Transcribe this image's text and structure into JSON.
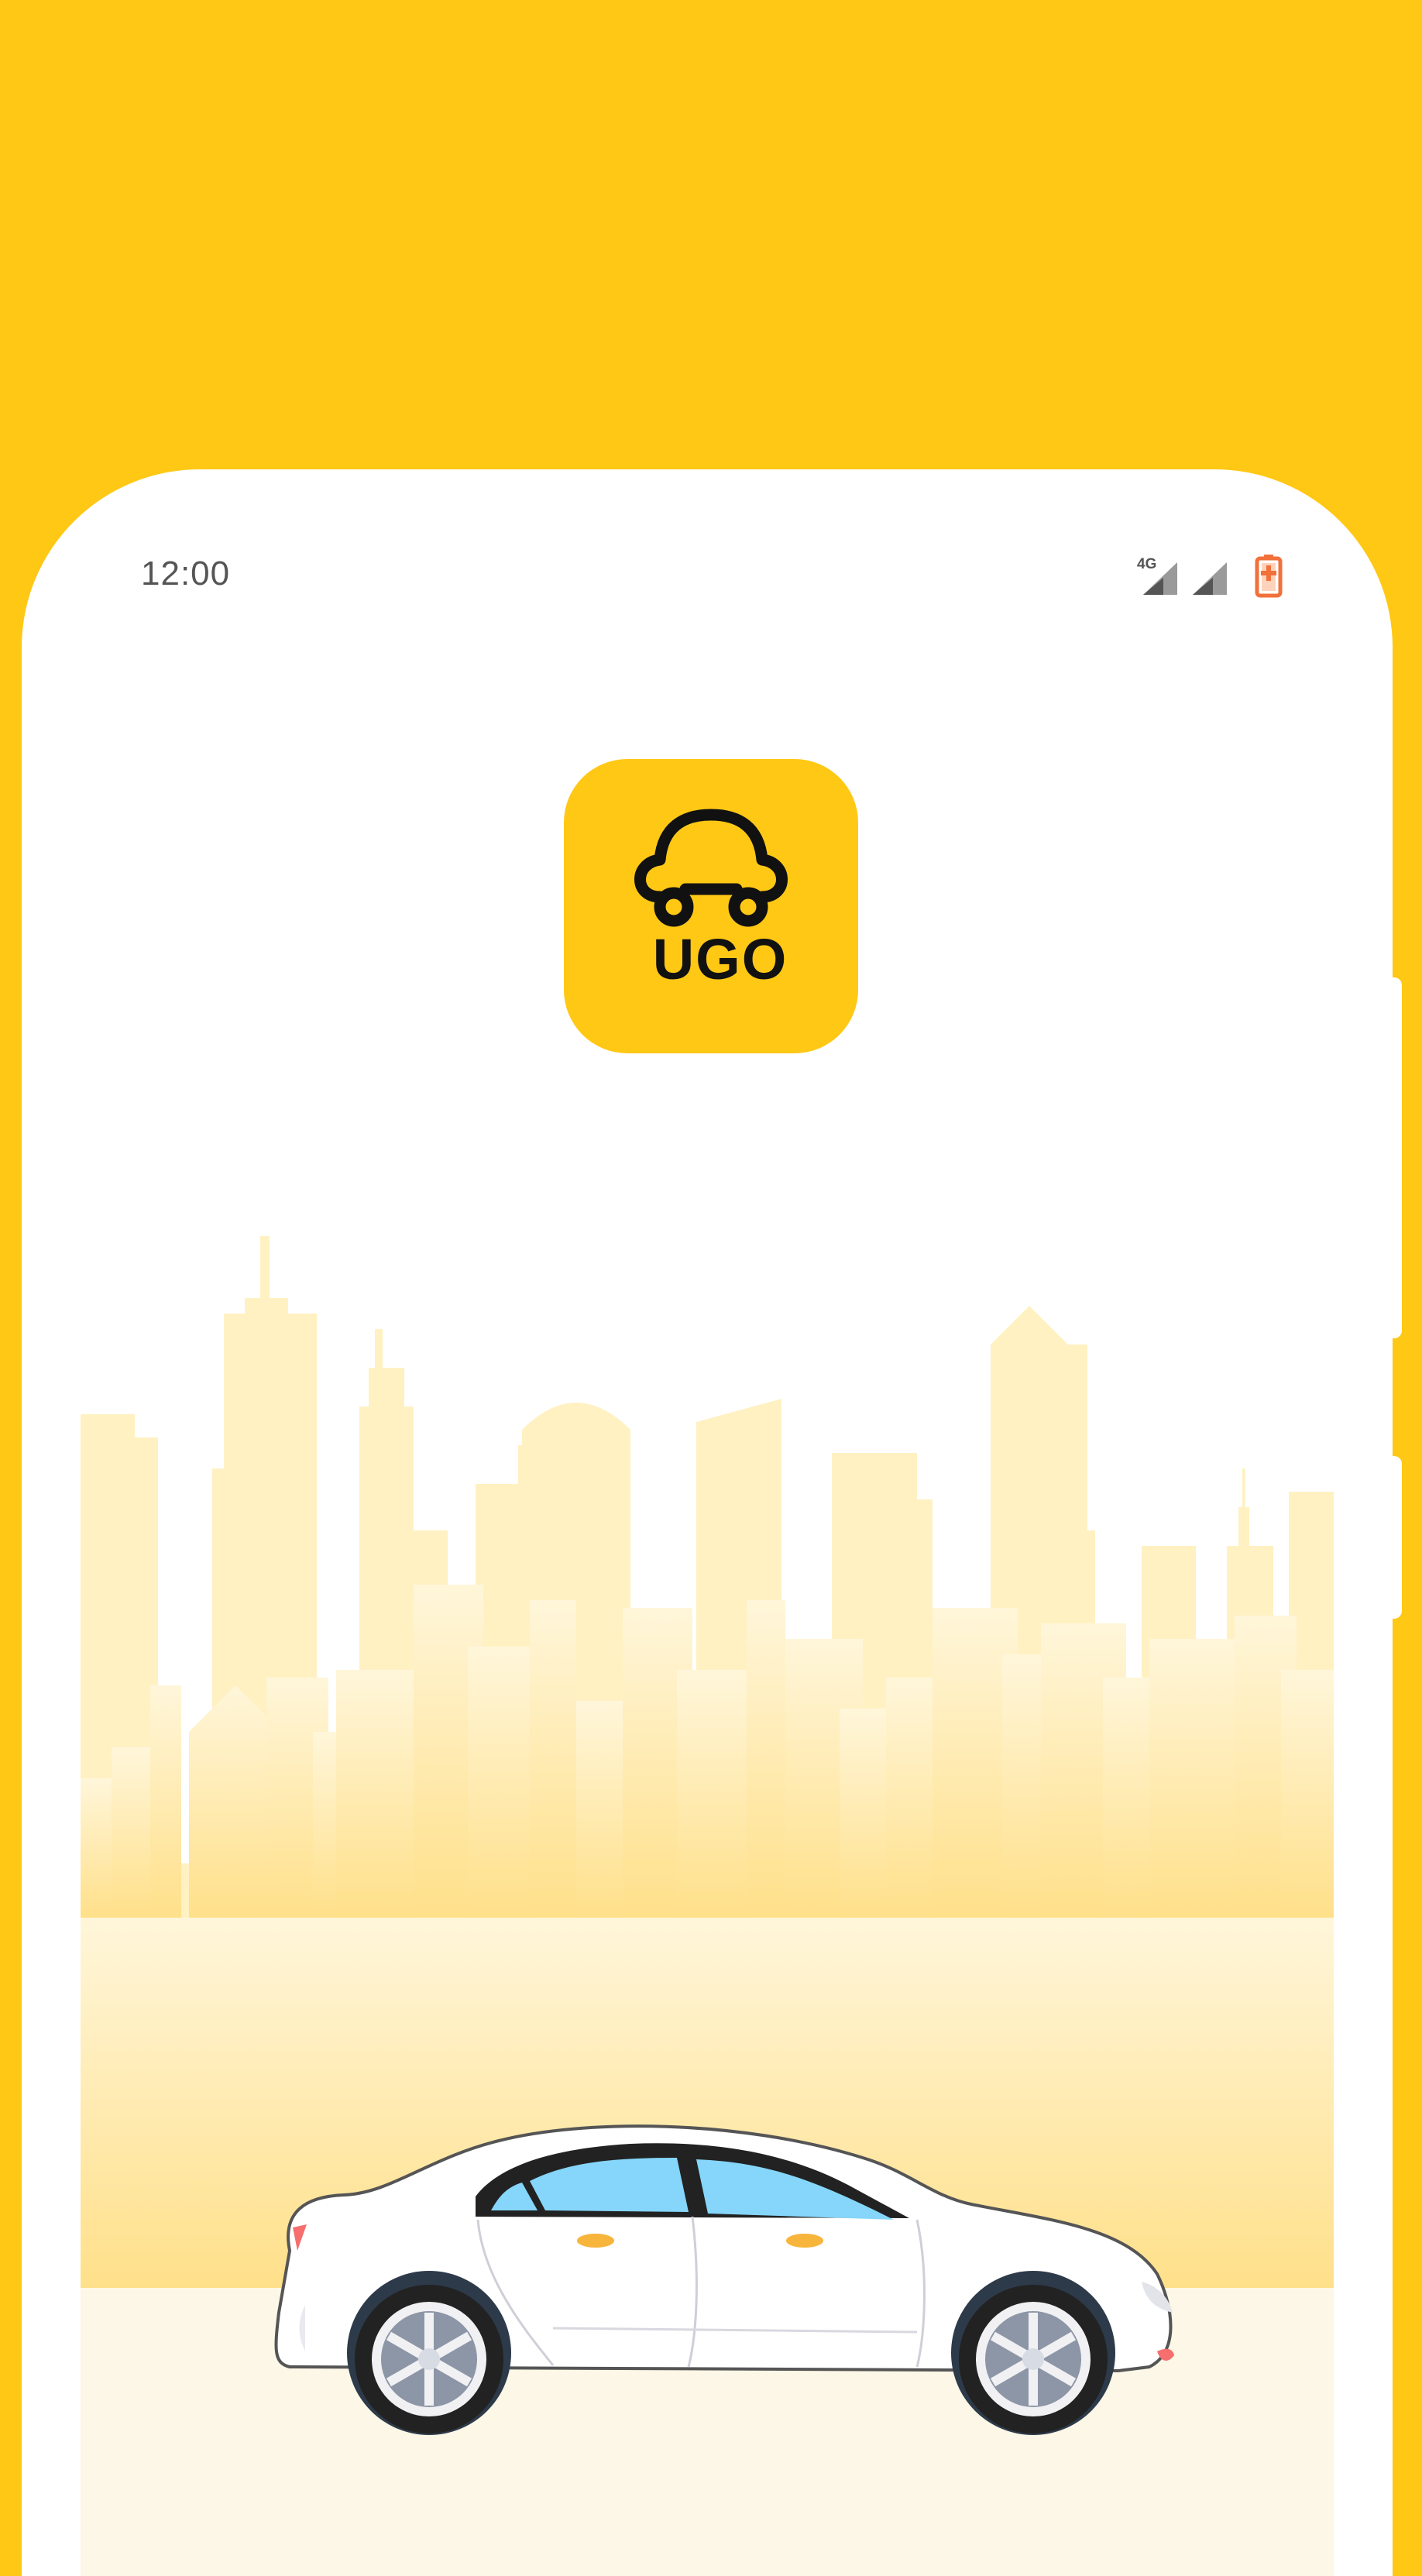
{
  "status_bar": {
    "time": "12:00",
    "network_label": "4G",
    "icons": [
      "4g-signal-icon",
      "signal-icon",
      "battery-charging-icon"
    ]
  },
  "splash": {
    "logo_text": "UGO",
    "logo_icon": "car-pin-logo-icon",
    "illustration": [
      "city-skyline",
      "white-sedan-car"
    ]
  },
  "colors": {
    "brand_yellow": "#FFC815",
    "skyline": "#FFE7A0",
    "ground": "#FCF7E6",
    "car_window": "#85D6FA",
    "battery": "#F2703A"
  }
}
